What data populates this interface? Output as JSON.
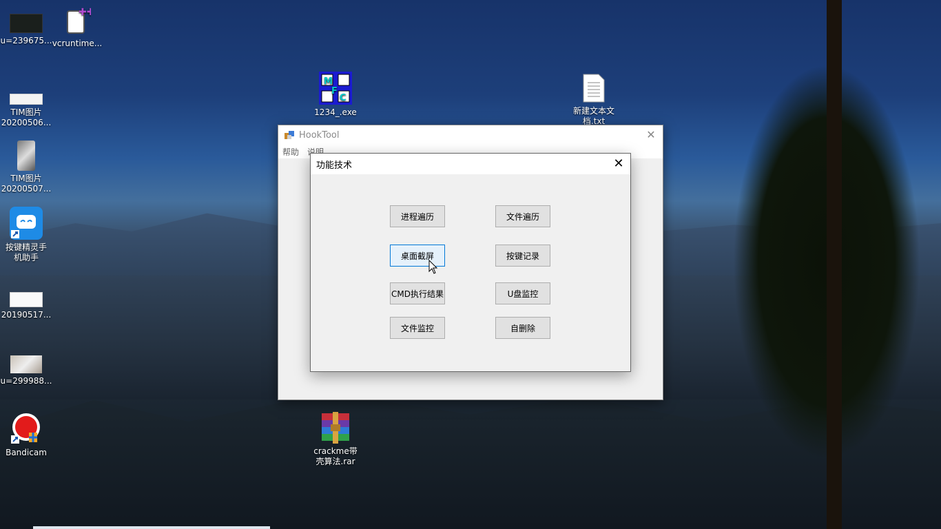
{
  "desktop": {
    "icons": [
      {
        "label": "u=239675...",
        "icon": "image-thumbnail-icon"
      },
      {
        "label": "vcruntime...",
        "icon": "file-plus-icon"
      },
      {
        "label": "TIM图片\n20200506...",
        "icon": "image-thumbnail-icon"
      },
      {
        "label": "TIM图片\n20200507...",
        "icon": "image-thumbnail-icon"
      },
      {
        "label": "按键精灵手\n机助手",
        "icon": "app-shortcut-icon"
      },
      {
        "label": "20190517...",
        "icon": "image-thumbnail-icon"
      },
      {
        "label": "u=299988...",
        "icon": "image-thumbnail-icon"
      },
      {
        "label": "Bandicam",
        "icon": "bandicam-icon"
      },
      {
        "label": "1234_.exe",
        "icon": "mfc-exe-icon"
      },
      {
        "label": "新建文本文\n档.txt",
        "icon": "text-file-icon"
      },
      {
        "label": "crackme带\n壳算法.rar",
        "icon": "winrar-archive-icon"
      }
    ]
  },
  "main_window": {
    "title": "HookTool",
    "close_glyph": "✕",
    "menu": [
      "帮助",
      "说明"
    ]
  },
  "dialog": {
    "title": "功能技术",
    "close_glyph": "✕",
    "buttons": {
      "process_list": "进程遍历",
      "file_list": "文件遍历",
      "screenshot": "桌面截屏",
      "keylogger": "按键记录",
      "cmd_result": "CMD执行结果",
      "usb_monitor": "U盘监控",
      "file_monitor": "文件监控",
      "self_delete": "自删除"
    },
    "hovered_button": "桌面截屏"
  }
}
